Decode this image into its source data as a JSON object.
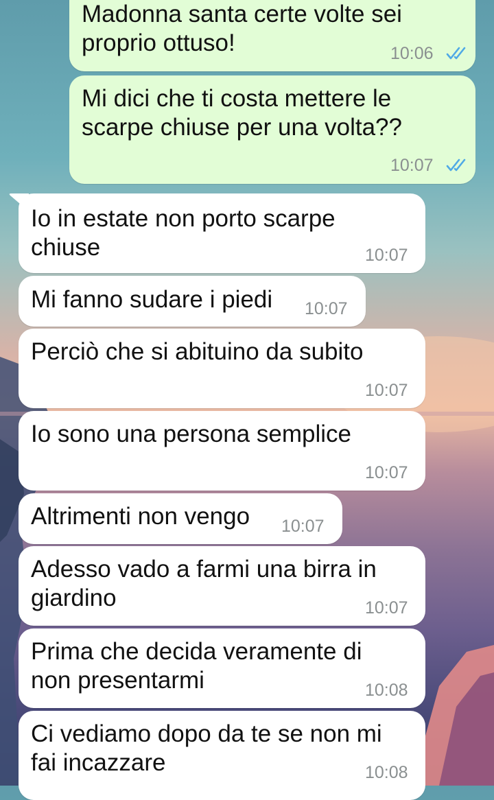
{
  "colors": {
    "outgoing_bubble": "#e2fdd6",
    "incoming_bubble": "#ffffff",
    "read_ticks": "#4fa9e6",
    "timestamp": "#8a8f90"
  },
  "messages": [
    {
      "direction": "outgoing",
      "text": "Madonna santa certe volte sei\nproprio ottuso!",
      "time": "10:06",
      "status": "read"
    },
    {
      "direction": "outgoing",
      "text": "Mi dici che ti costa mettere le\nscarpe chiuse per una volta??",
      "time": "10:07",
      "status": "read"
    },
    {
      "direction": "incoming",
      "text": "Io in estate non porto scarpe\nchiuse",
      "time": "10:07"
    },
    {
      "direction": "incoming",
      "text": "Mi fanno sudare i piedi",
      "time": "10:07"
    },
    {
      "direction": "incoming",
      "text": "Perciò che si abituino da subito",
      "time": "10:07"
    },
    {
      "direction": "incoming",
      "text": "Io sono una persona semplice",
      "time": "10:07"
    },
    {
      "direction": "incoming",
      "text": "Altrimenti non vengo",
      "time": "10:07"
    },
    {
      "direction": "incoming",
      "text": "Adesso vado a farmi una birra in\ngiardino",
      "time": "10:07"
    },
    {
      "direction": "incoming",
      "text": "Prima che decida veramente di\nnon presentarmi",
      "time": "10:08"
    },
    {
      "direction": "incoming",
      "text": "Ci vediamo dopo da te se non mi\nfai incazzare",
      "time": "10:08"
    }
  ]
}
